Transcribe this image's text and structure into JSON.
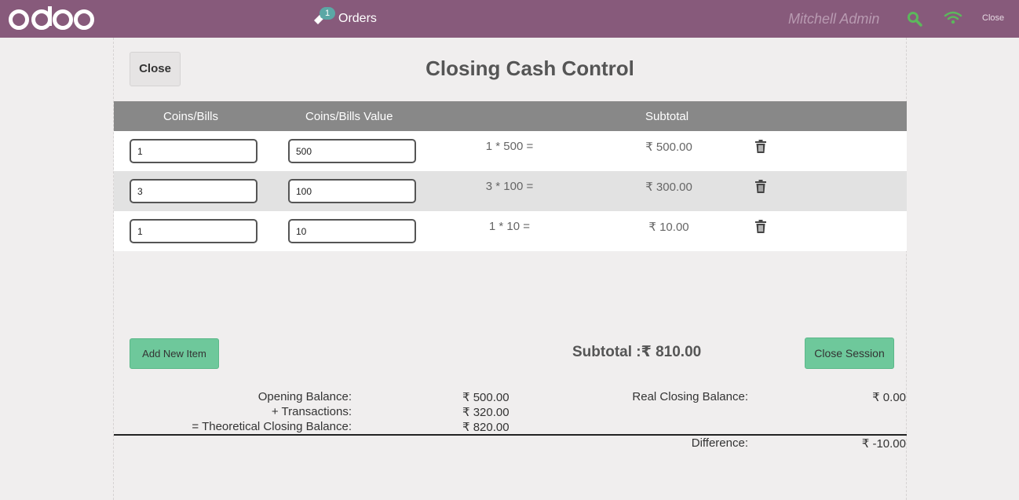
{
  "header": {
    "logo_text": "odoo",
    "orders_badge": "1",
    "orders_label": "Orders",
    "user_name": "Mitchell Admin",
    "close_label": "Close",
    "brand_color": "#875a7b",
    "icons": [
      "tag-icon",
      "search-icon",
      "wifi-icon"
    ]
  },
  "panel": {
    "close_label": "Close",
    "title": "Closing Cash Control",
    "columns": [
      "Coins/Bills",
      "Coins/Bills Value",
      "Subtotal"
    ],
    "rows": [
      {
        "count": "1",
        "value": "500",
        "formula": "1 * 500 =",
        "subtotal": "₹ 500.00"
      },
      {
        "count": "3",
        "value": "100",
        "formula": "3 * 100 =",
        "subtotal": "₹ 300.00"
      },
      {
        "count": "1",
        "value": "10",
        "formula": "1 * 10 =",
        "subtotal": "₹ 10.00"
      }
    ],
    "add_label": "Add New Item",
    "subtotal_text": "Subtotal :₹ 810.00",
    "close_session_label": "Close Session",
    "accent_color": "#6ec89b"
  },
  "balances": {
    "opening_label": "Opening Balance:",
    "opening_value": "₹ 500.00",
    "transactions_label": "+ Transactions:",
    "transactions_value": "₹ 320.00",
    "theoretical_label": "= Theoretical Closing Balance:",
    "theoretical_value": "₹ 820.00",
    "real_label": "Real Closing Balance:",
    "real_value": "₹ 0.00",
    "difference_label": "Difference:",
    "difference_value": "₹ -10.00"
  }
}
